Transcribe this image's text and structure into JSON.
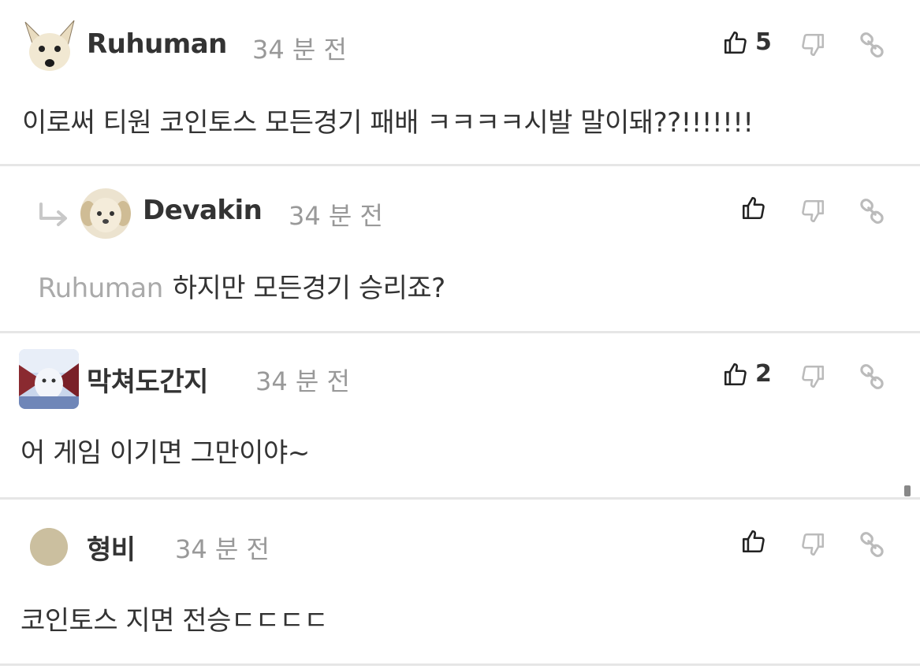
{
  "comments": [
    {
      "author": "Ruhuman",
      "time": "34 분 전",
      "body": "이로써 티원 코인토스 모든경기 패배 ㅋㅋㅋㅋ시발 말이돼??!!!!!!!",
      "likes": "5",
      "avatar_icon": "dog-face-avatar",
      "is_reply": false
    },
    {
      "author": "Devakin",
      "time": "34 분 전",
      "mention": "Ruhuman",
      "body": "하지만 모든경기 승리죠?",
      "likes": "",
      "avatar_icon": "puppy-face-avatar",
      "is_reply": true
    },
    {
      "author": "막쳐도간지",
      "time": "34 분 전",
      "body": "어 게임 이기면 그만이야~",
      "likes": "2",
      "avatar_icon": "photo-avatar",
      "is_reply": false
    },
    {
      "author": "형비",
      "time": "34 분 전",
      "body": "코인토스 지면 전승ㄷㄷㄷㄷ",
      "likes": "",
      "avatar_icon": "default-circle-avatar",
      "is_reply": false
    }
  ],
  "icons": {
    "like": "thumbs-up-icon",
    "dislike": "thumbs-down-icon",
    "link": "link-icon",
    "reply": "reply-arrow-icon"
  },
  "colors": {
    "text": "#333333",
    "muted": "#999999",
    "icon_dim": "#bbbbbb",
    "divider": "#e6e6e6"
  }
}
